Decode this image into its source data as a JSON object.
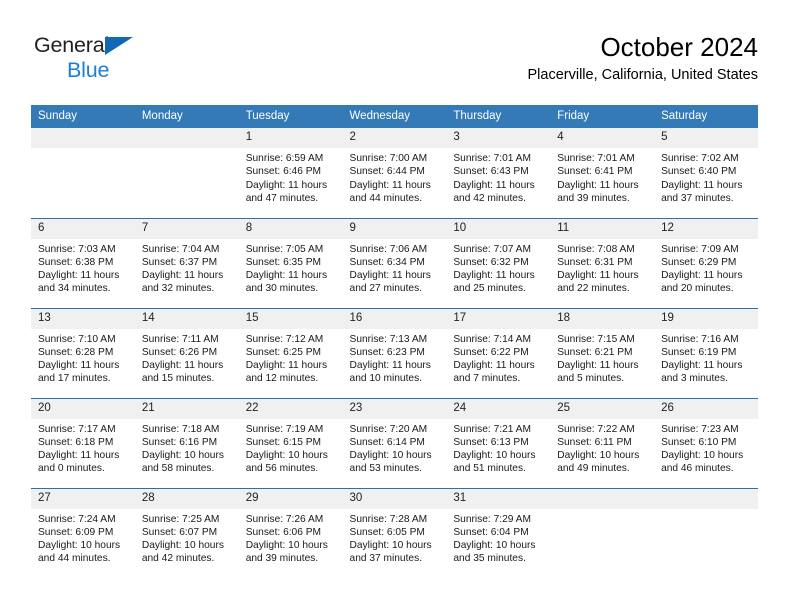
{
  "brand": {
    "name_top": "General",
    "name_bottom": "Blue",
    "triangle_color": "#1268b3",
    "blue_text_color": "#1b7fd4"
  },
  "header": {
    "title": "October 2024",
    "subtitle": "Placerville, California, United States"
  },
  "theme": {
    "header_row_bg": "#337ab7",
    "header_row_text": "#ffffff",
    "daynum_bg": "#f0f0f0",
    "row_divider": "#2f6fa8",
    "body_text": "#1a1a1a"
  },
  "weekday_headers": [
    "Sunday",
    "Monday",
    "Tuesday",
    "Wednesday",
    "Thursday",
    "Friday",
    "Saturday"
  ],
  "weeks": [
    [
      {
        "day": "",
        "sunrise": "",
        "sunset": "",
        "daylight_line1": "",
        "daylight_line2": "",
        "empty": true
      },
      {
        "day": "",
        "sunrise": "",
        "sunset": "",
        "daylight_line1": "",
        "daylight_line2": "",
        "empty": true
      },
      {
        "day": "1",
        "sunrise": "Sunrise: 6:59 AM",
        "sunset": "Sunset: 6:46 PM",
        "daylight_line1": "Daylight: 11 hours",
        "daylight_line2": "and 47 minutes."
      },
      {
        "day": "2",
        "sunrise": "Sunrise: 7:00 AM",
        "sunset": "Sunset: 6:44 PM",
        "daylight_line1": "Daylight: 11 hours",
        "daylight_line2": "and 44 minutes."
      },
      {
        "day": "3",
        "sunrise": "Sunrise: 7:01 AM",
        "sunset": "Sunset: 6:43 PM",
        "daylight_line1": "Daylight: 11 hours",
        "daylight_line2": "and 42 minutes."
      },
      {
        "day": "4",
        "sunrise": "Sunrise: 7:01 AM",
        "sunset": "Sunset: 6:41 PM",
        "daylight_line1": "Daylight: 11 hours",
        "daylight_line2": "and 39 minutes."
      },
      {
        "day": "5",
        "sunrise": "Sunrise: 7:02 AM",
        "sunset": "Sunset: 6:40 PM",
        "daylight_line1": "Daylight: 11 hours",
        "daylight_line2": "and 37 minutes."
      }
    ],
    [
      {
        "day": "6",
        "sunrise": "Sunrise: 7:03 AM",
        "sunset": "Sunset: 6:38 PM",
        "daylight_line1": "Daylight: 11 hours",
        "daylight_line2": "and 34 minutes."
      },
      {
        "day": "7",
        "sunrise": "Sunrise: 7:04 AM",
        "sunset": "Sunset: 6:37 PM",
        "daylight_line1": "Daylight: 11 hours",
        "daylight_line2": "and 32 minutes."
      },
      {
        "day": "8",
        "sunrise": "Sunrise: 7:05 AM",
        "sunset": "Sunset: 6:35 PM",
        "daylight_line1": "Daylight: 11 hours",
        "daylight_line2": "and 30 minutes."
      },
      {
        "day": "9",
        "sunrise": "Sunrise: 7:06 AM",
        "sunset": "Sunset: 6:34 PM",
        "daylight_line1": "Daylight: 11 hours",
        "daylight_line2": "and 27 minutes."
      },
      {
        "day": "10",
        "sunrise": "Sunrise: 7:07 AM",
        "sunset": "Sunset: 6:32 PM",
        "daylight_line1": "Daylight: 11 hours",
        "daylight_line2": "and 25 minutes."
      },
      {
        "day": "11",
        "sunrise": "Sunrise: 7:08 AM",
        "sunset": "Sunset: 6:31 PM",
        "daylight_line1": "Daylight: 11 hours",
        "daylight_line2": "and 22 minutes."
      },
      {
        "day": "12",
        "sunrise": "Sunrise: 7:09 AM",
        "sunset": "Sunset: 6:29 PM",
        "daylight_line1": "Daylight: 11 hours",
        "daylight_line2": "and 20 minutes."
      }
    ],
    [
      {
        "day": "13",
        "sunrise": "Sunrise: 7:10 AM",
        "sunset": "Sunset: 6:28 PM",
        "daylight_line1": "Daylight: 11 hours",
        "daylight_line2": "and 17 minutes."
      },
      {
        "day": "14",
        "sunrise": "Sunrise: 7:11 AM",
        "sunset": "Sunset: 6:26 PM",
        "daylight_line1": "Daylight: 11 hours",
        "daylight_line2": "and 15 minutes."
      },
      {
        "day": "15",
        "sunrise": "Sunrise: 7:12 AM",
        "sunset": "Sunset: 6:25 PM",
        "daylight_line1": "Daylight: 11 hours",
        "daylight_line2": "and 12 minutes."
      },
      {
        "day": "16",
        "sunrise": "Sunrise: 7:13 AM",
        "sunset": "Sunset: 6:23 PM",
        "daylight_line1": "Daylight: 11 hours",
        "daylight_line2": "and 10 minutes."
      },
      {
        "day": "17",
        "sunrise": "Sunrise: 7:14 AM",
        "sunset": "Sunset: 6:22 PM",
        "daylight_line1": "Daylight: 11 hours",
        "daylight_line2": "and 7 minutes."
      },
      {
        "day": "18",
        "sunrise": "Sunrise: 7:15 AM",
        "sunset": "Sunset: 6:21 PM",
        "daylight_line1": "Daylight: 11 hours",
        "daylight_line2": "and 5 minutes."
      },
      {
        "day": "19",
        "sunrise": "Sunrise: 7:16 AM",
        "sunset": "Sunset: 6:19 PM",
        "daylight_line1": "Daylight: 11 hours",
        "daylight_line2": "and 3 minutes."
      }
    ],
    [
      {
        "day": "20",
        "sunrise": "Sunrise: 7:17 AM",
        "sunset": "Sunset: 6:18 PM",
        "daylight_line1": "Daylight: 11 hours",
        "daylight_line2": "and 0 minutes."
      },
      {
        "day": "21",
        "sunrise": "Sunrise: 7:18 AM",
        "sunset": "Sunset: 6:16 PM",
        "daylight_line1": "Daylight: 10 hours",
        "daylight_line2": "and 58 minutes."
      },
      {
        "day": "22",
        "sunrise": "Sunrise: 7:19 AM",
        "sunset": "Sunset: 6:15 PM",
        "daylight_line1": "Daylight: 10 hours",
        "daylight_line2": "and 56 minutes."
      },
      {
        "day": "23",
        "sunrise": "Sunrise: 7:20 AM",
        "sunset": "Sunset: 6:14 PM",
        "daylight_line1": "Daylight: 10 hours",
        "daylight_line2": "and 53 minutes."
      },
      {
        "day": "24",
        "sunrise": "Sunrise: 7:21 AM",
        "sunset": "Sunset: 6:13 PM",
        "daylight_line1": "Daylight: 10 hours",
        "daylight_line2": "and 51 minutes."
      },
      {
        "day": "25",
        "sunrise": "Sunrise: 7:22 AM",
        "sunset": "Sunset: 6:11 PM",
        "daylight_line1": "Daylight: 10 hours",
        "daylight_line2": "and 49 minutes."
      },
      {
        "day": "26",
        "sunrise": "Sunrise: 7:23 AM",
        "sunset": "Sunset: 6:10 PM",
        "daylight_line1": "Daylight: 10 hours",
        "daylight_line2": "and 46 minutes."
      }
    ],
    [
      {
        "day": "27",
        "sunrise": "Sunrise: 7:24 AM",
        "sunset": "Sunset: 6:09 PM",
        "daylight_line1": "Daylight: 10 hours",
        "daylight_line2": "and 44 minutes."
      },
      {
        "day": "28",
        "sunrise": "Sunrise: 7:25 AM",
        "sunset": "Sunset: 6:07 PM",
        "daylight_line1": "Daylight: 10 hours",
        "daylight_line2": "and 42 minutes."
      },
      {
        "day": "29",
        "sunrise": "Sunrise: 7:26 AM",
        "sunset": "Sunset: 6:06 PM",
        "daylight_line1": "Daylight: 10 hours",
        "daylight_line2": "and 39 minutes."
      },
      {
        "day": "30",
        "sunrise": "Sunrise: 7:28 AM",
        "sunset": "Sunset: 6:05 PM",
        "daylight_line1": "Daylight: 10 hours",
        "daylight_line2": "and 37 minutes."
      },
      {
        "day": "31",
        "sunrise": "Sunrise: 7:29 AM",
        "sunset": "Sunset: 6:04 PM",
        "daylight_line1": "Daylight: 10 hours",
        "daylight_line2": "and 35 minutes."
      },
      {
        "day": "",
        "sunrise": "",
        "sunset": "",
        "daylight_line1": "",
        "daylight_line2": "",
        "empty": true
      },
      {
        "day": "",
        "sunrise": "",
        "sunset": "",
        "daylight_line1": "",
        "daylight_line2": "",
        "empty": true
      }
    ]
  ]
}
